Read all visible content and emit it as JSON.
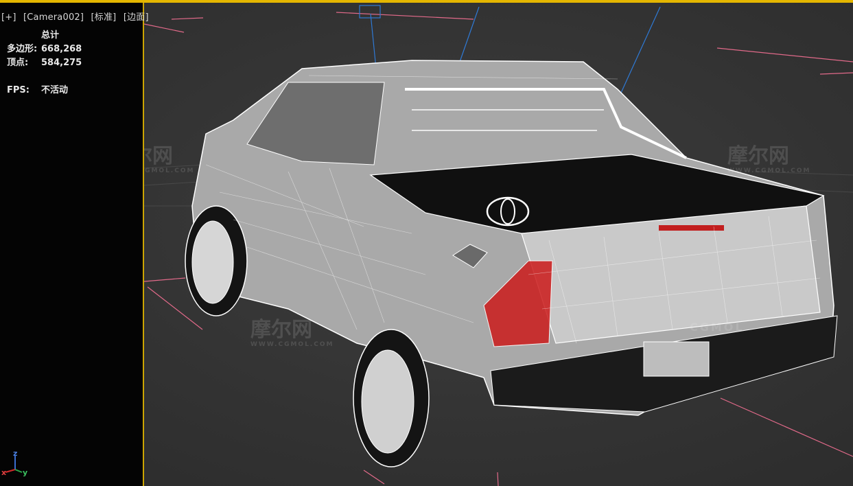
{
  "viewport": {
    "labels": [
      "[+]",
      "[Camera002]",
      "[标准]",
      "[边面]"
    ]
  },
  "stats": {
    "header": "总计",
    "polygons_label": "多边形:",
    "polygons_value": "668,268",
    "vertices_label": "顶点:",
    "vertices_value": "584,275",
    "fps_label": "FPS:",
    "fps_value": "不活动"
  },
  "watermarks": {
    "brand": "摩尔网",
    "domain": "WWW.CGMOL.COM",
    "cgmol": "CGMOL"
  },
  "axis": {
    "z": "z",
    "x": "x",
    "y": "y"
  },
  "colors": {
    "accent": "#e4b600",
    "wire": "#f2f2f2",
    "grid_pink": "#e26a8a",
    "light_blue": "#2f7ad6",
    "taillight": "#cc1b1b"
  }
}
